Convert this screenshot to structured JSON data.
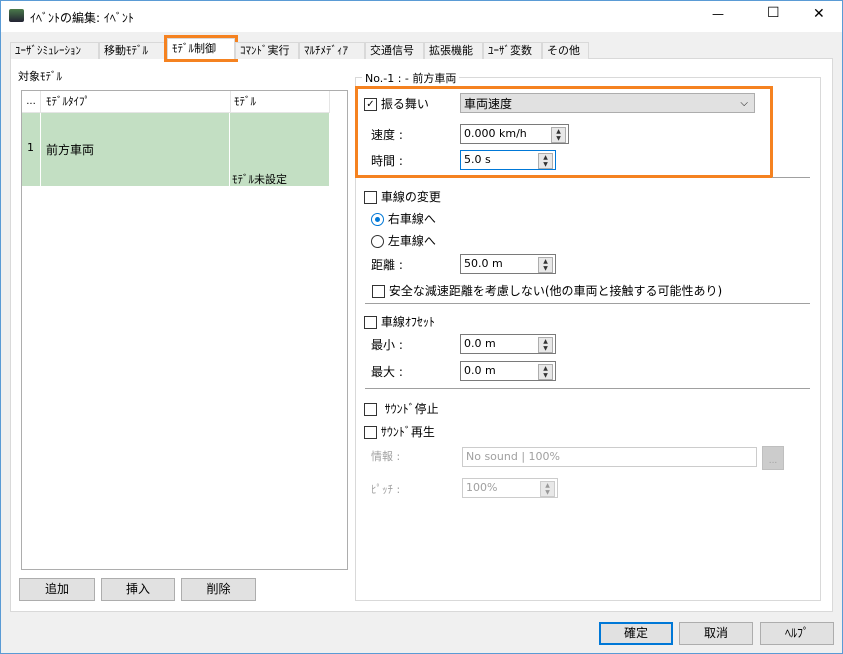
{
  "window": {
    "title": "ｲﾍﾞﾝﾄの編集: ｲﾍﾞﾝﾄ",
    "minimize": "—",
    "maximize": "☐",
    "close": "✕"
  },
  "tabs": [
    {
      "label": "ﾕｰｻﾞｼﾐｭﾚｰｼｮﾝ"
    },
    {
      "label": "移動ﾓﾃﾞﾙ"
    },
    {
      "label": "ﾓﾃﾞﾙ制御",
      "active": true
    },
    {
      "label": "ｺﾏﾝﾄﾞ実行"
    },
    {
      "label": "ﾏﾙﾁﾒﾃﾞｨｱ"
    },
    {
      "label": "交通信号"
    },
    {
      "label": "拡張機能"
    },
    {
      "label": "ﾕｰｻﾞ変数"
    },
    {
      "label": "その他"
    }
  ],
  "left": {
    "group_label": "対象ﾓﾃﾞﾙ",
    "columns": [
      "...",
      "ﾓﾃﾞﾙﾀｲﾌﾟ",
      "ﾓﾃﾞﾙ"
    ],
    "rows": [
      {
        "index": "1",
        "type": "前方車両",
        "model": "ﾓﾃﾞﾙ未設定"
      }
    ],
    "selected_row_color": "#c3dfc3",
    "buttons": {
      "add": "追加",
      "insert": "挿入",
      "delete": "削除"
    }
  },
  "right": {
    "group_label": "No.-1 : - 前方車両",
    "behavior": {
      "label": "振る舞い",
      "checked": true,
      "select_value": "車両速度",
      "speed_label": "速度 :",
      "speed_value": "0.000 km/h",
      "time_label": "時間 :",
      "time_value": "5.0 s"
    },
    "lane_change": {
      "label": "車線の変更",
      "checked": false,
      "right_label": "右車線へ",
      "left_label": "左車線へ",
      "selected": "right",
      "distance_label": "距離 :",
      "distance_value": "50.0 m",
      "safe_label": "安全な減速距離を考慮しない(他の車両と接触する可能性あり)",
      "safe_checked": false
    },
    "lane_offset": {
      "label": "車線ｵﾌｾｯﾄ",
      "checked": false,
      "min_label": "最小 :",
      "min_value": "0.0 m",
      "max_label": "最大 :",
      "max_value": "0.0 m"
    },
    "sound_stop": {
      "label": "ｻｳﾝﾄﾞ停止",
      "checked": false
    },
    "sound_play": {
      "label": "ｻｳﾝﾄﾞ再生",
      "checked": false,
      "info_label": "情報 :",
      "info_value": "No sound | 100%",
      "browse": "...",
      "pitch_label": "ﾋﾟｯﾁ :",
      "pitch_value": "100%"
    }
  },
  "footer": {
    "ok": "確定",
    "cancel": "取消",
    "help": "ﾍﾙﾌﾟ"
  },
  "highlight_color": "#f58220"
}
